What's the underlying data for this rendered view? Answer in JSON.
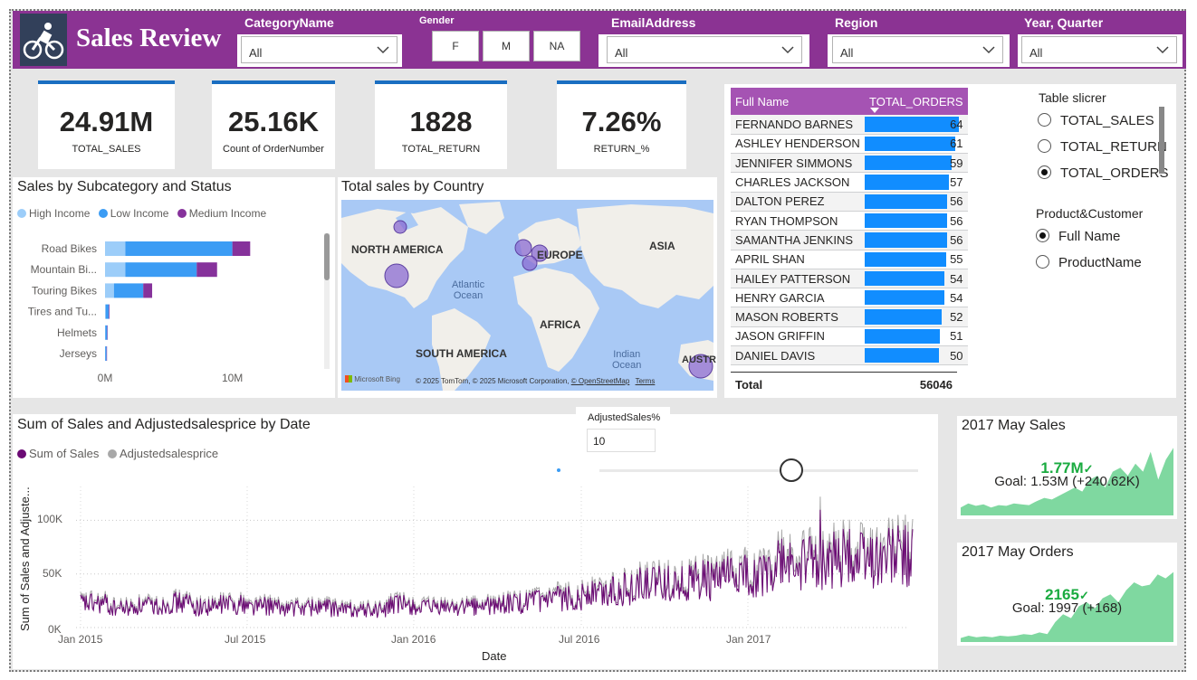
{
  "header": {
    "title": "Sales Review",
    "slicers": {
      "category": {
        "label": "CategoryName",
        "value": "All"
      },
      "gender": {
        "label": "Gender",
        "options": [
          "F",
          "M",
          "NA"
        ]
      },
      "email": {
        "label": "EmailAddress",
        "value": "All"
      },
      "region": {
        "label": "Region",
        "value": "All"
      },
      "year_quarter": {
        "label": "Year, Quarter",
        "value": "All"
      }
    }
  },
  "kpis": [
    {
      "value": "24.91M",
      "label": "TOTAL_SALES"
    },
    {
      "value": "25.16K",
      "label": "Count of OrderNumber"
    },
    {
      "value": "1828",
      "label": "TOTAL_RETURN"
    },
    {
      "value": "7.26%",
      "label": "RETURN_%"
    }
  ],
  "subcategory_chart": {
    "title": "Sales by Subcategory and Status",
    "legend": [
      {
        "name": "High Income",
        "color": "#9ccdf9"
      },
      {
        "name": "Low Income",
        "color": "#3b9cf4"
      },
      {
        "name": "Medium Income",
        "color": "#86329b"
      }
    ],
    "x_ticks": [
      "0M",
      "10M"
    ]
  },
  "map": {
    "title": "Total sales by Country",
    "labels": {
      "north_america": "NORTH AMERICA",
      "europe": "EUROPE",
      "asia": "ASIA",
      "africa": "AFRICA",
      "south_america": "SOUTH AMERICA",
      "atlantic": "Atlantic",
      "ocean": "Ocean",
      "indian": "Indian",
      "ocean2": "Ocean",
      "australia": "AUSTR"
    },
    "attribution": "© 2025 TomTom, © 2025 Microsoft Corporation,",
    "osm_link": "© OpenStreetMap",
    "terms": "Terms",
    "bing": "Microsoft Bing"
  },
  "orders_table": {
    "columns": [
      "Full Name",
      "TOTAL_ORDERS"
    ],
    "rows": [
      {
        "name": "FERNANDO BARNES",
        "orders": 64
      },
      {
        "name": "ASHLEY HENDERSON",
        "orders": 61
      },
      {
        "name": "JENNIFER SIMMONS",
        "orders": 59
      },
      {
        "name": "CHARLES JACKSON",
        "orders": 57
      },
      {
        "name": "DALTON PEREZ",
        "orders": 56
      },
      {
        "name": "RYAN THOMPSON",
        "orders": 56
      },
      {
        "name": "SAMANTHA JENKINS",
        "orders": 56
      },
      {
        "name": "APRIL SHAN",
        "orders": 55
      },
      {
        "name": "HAILEY PATTERSON",
        "orders": 54
      },
      {
        "name": "HENRY GARCIA",
        "orders": 54
      },
      {
        "name": "MASON ROBERTS",
        "orders": 52
      },
      {
        "name": "JASON GRIFFIN",
        "orders": 51
      },
      {
        "name": "DANIEL DAVIS",
        "orders": 50
      }
    ],
    "total_label": "Total",
    "total_value": "56046",
    "max_orders": 64
  },
  "table_slicer": {
    "title": "Table slicrer",
    "options": [
      {
        "label": "TOTAL_SALES",
        "selected": false
      },
      {
        "label": "TOTAL_RETURN",
        "selected": false
      },
      {
        "label": "TOTAL_ORDERS",
        "selected": true
      }
    ]
  },
  "pc_slicer": {
    "title": "Product&Customer",
    "options": [
      {
        "label": "Full Name",
        "selected": true
      },
      {
        "label": "ProductName",
        "selected": false
      }
    ]
  },
  "line_chart": {
    "title": "Sum of Sales and Adjustedsalesprice by Date",
    "legend": [
      {
        "name": "Sum of Sales",
        "color": "#6b0a74"
      },
      {
        "name": "Adjustedsalesprice",
        "color": "#a8a8a8"
      }
    ],
    "y_title": "Sum of Sales and Adjuste...",
    "x_title": "Date",
    "y_ticks": [
      "100K",
      "50K",
      "0K"
    ],
    "x_ticks": [
      "Jan 2015",
      "Jul 2015",
      "Jan 2016",
      "Jul 2016",
      "Jan 2017"
    ]
  },
  "adjust_param": {
    "label": "AdjustedSales%",
    "value": "10"
  },
  "may_sales": {
    "title": "2017 May Sales",
    "value": "1.77M",
    "goal": "Goal: 1.53M (+240.62K)"
  },
  "may_orders": {
    "title": "2017 May Orders",
    "value": "2165",
    "goal": "Goal: 1997 (+168)"
  },
  "chart_data": [
    {
      "type": "bar",
      "title": "Sales by Subcategory and Status",
      "categories": [
        "Road Bikes",
        "Mountain Bi...",
        "Touring Bikes",
        "Tires and Tu...",
        "Helmets",
        "Jerseys"
      ],
      "series": [
        {
          "name": "High Income",
          "values": [
            1.6,
            1.6,
            0.7,
            0.05,
            0.03,
            0.02
          ]
        },
        {
          "name": "Low Income",
          "values": [
            8.4,
            5.6,
            2.3,
            0.25,
            0.14,
            0.1
          ]
        },
        {
          "name": "Medium Income",
          "values": [
            1.4,
            1.6,
            0.7,
            0.05,
            0.03,
            0.02
          ]
        }
      ],
      "stacked": true,
      "orientation": "horizontal",
      "xlim": [
        0,
        16
      ],
      "x_ticks": [
        "0M",
        "10M"
      ]
    },
    {
      "type": "line",
      "title": "Sum of Sales and Adjustedsalesprice by Date",
      "x_range": [
        "2015-01-01",
        "2017-06-30"
      ],
      "ylim": [
        0,
        140000
      ],
      "series": [
        {
          "name": "Sum of Sales",
          "monthly_average": [
            22000,
            18000,
            20000,
            23000,
            19000,
            22000,
            20000,
            18000,
            19000,
            17000,
            16000,
            21000,
            18000,
            19000,
            20000,
            22000,
            24000,
            27000,
            32000,
            36000,
            40000,
            42000,
            44000,
            47000,
            50000,
            58000,
            60000,
            64000,
            66000,
            68000
          ]
        },
        {
          "name": "Adjustedsalesprice",
          "monthly_average": [
            24000,
            20000,
            22000,
            25000,
            21000,
            24000,
            22000,
            20000,
            21000,
            19000,
            18000,
            23000,
            20000,
            21000,
            22000,
            24000,
            26000,
            30000,
            35000,
            39000,
            44000,
            46000,
            48000,
            52000,
            55000,
            64000,
            66000,
            70000,
            73000,
            75000
          ]
        }
      ]
    }
  ]
}
